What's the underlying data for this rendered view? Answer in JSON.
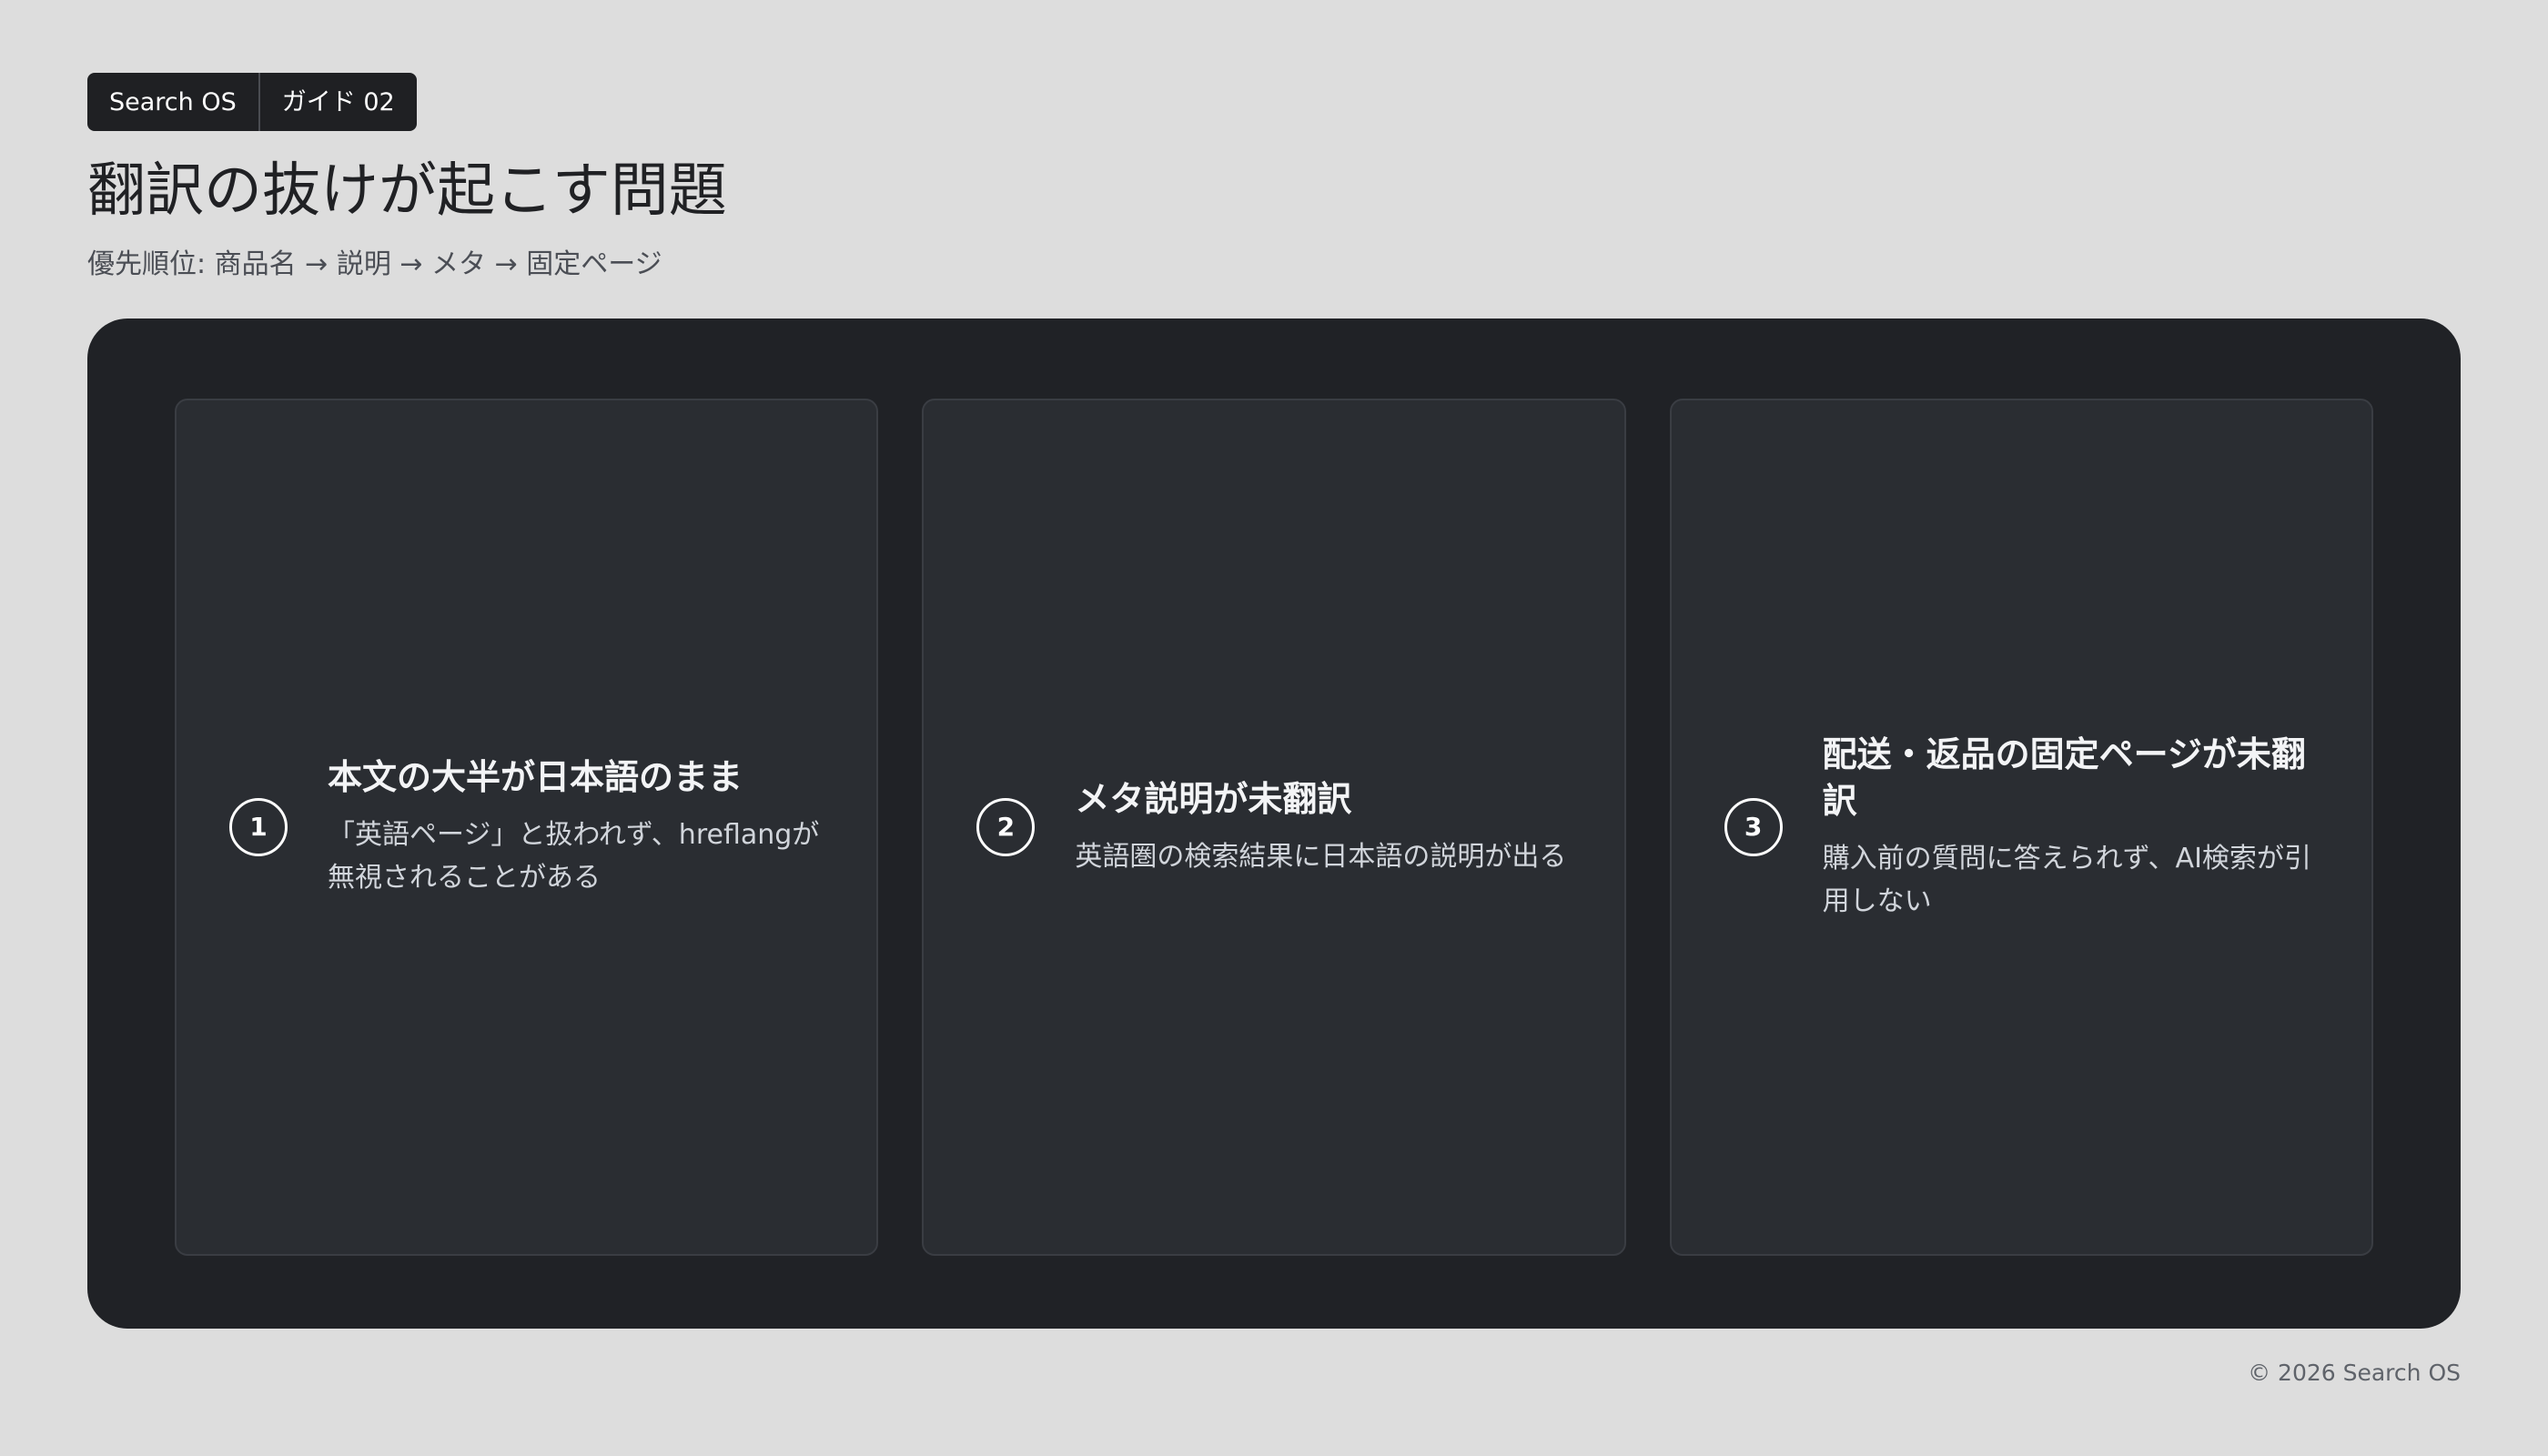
{
  "brand": {
    "name": "Search OS",
    "guide_label": "ガイド 02"
  },
  "page": {
    "title": "翻訳の抜けが起こす問題",
    "subtitle": "優先順位: 商品名 → 説明 → メタ → 固定ページ"
  },
  "cards": [
    {
      "number": "1",
      "title": "本文の大半が日本語のまま",
      "description": "「英語ページ」と扱われず、hreflangが無視されることがある"
    },
    {
      "number": "2",
      "title": "メタ説明が未翻訳",
      "description": "英語圏の検索結果に日本語の説明が出る"
    },
    {
      "number": "3",
      "title": "配送・返品の固定ページが未翻訳",
      "description": "購入前の質問に答えられず、AI検索が引用しない"
    }
  ],
  "footer": {
    "copyright": "© 2026 Search OS"
  },
  "colors": {
    "background": "#dddddd",
    "panel": "#202226",
    "card": "#2a2d32",
    "card_border": "#3a3d43",
    "text_primary": "#202124",
    "text_on_dark": "#f3f4f6"
  }
}
